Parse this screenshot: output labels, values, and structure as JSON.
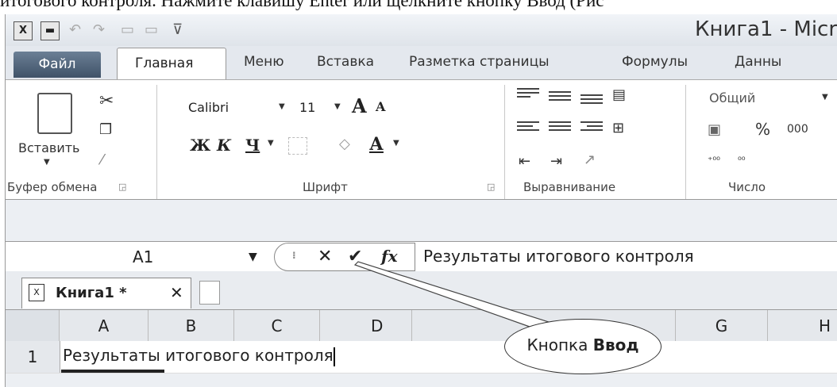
{
  "caption": "итогового контроля. Нажмите клавишу Enter или щелкните кнопку Ввод (Рис",
  "app": {
    "title": "Книга1 - Micr"
  },
  "tabs": [
    "Файл",
    "Главная",
    "Меню",
    "Вставка",
    "Разметка страницы",
    "Формулы",
    "Данны"
  ],
  "ribbon": {
    "clipboard": {
      "paste_label": "Вставить",
      "group_label": "Буфер обмена"
    },
    "font": {
      "name": "Calibri",
      "size": "11",
      "bold": "Ж",
      "italic": "К",
      "underline": "Ч",
      "color_label": "А",
      "group_label": "Шрифт"
    },
    "alignment": {
      "group_label": "Выравнивание"
    },
    "number": {
      "format": "Общий",
      "percent": "%",
      "thousands": "000",
      "group_label": "Число"
    }
  },
  "formula_bar": {
    "name_box": "A1",
    "cancel": "✕",
    "enter": "✔",
    "fx": "fx",
    "content": "Результаты итогового контроля"
  },
  "workbook_tab": {
    "name": "Книга1 *",
    "close": "✕"
  },
  "columns": [
    "A",
    "B",
    "C",
    "D",
    "G",
    "H"
  ],
  "rows": [
    {
      "num": "1",
      "a1": "Результаты итогового контроля"
    }
  ],
  "callout": {
    "prefix": "Кнопка ",
    "bold": "Ввод"
  }
}
